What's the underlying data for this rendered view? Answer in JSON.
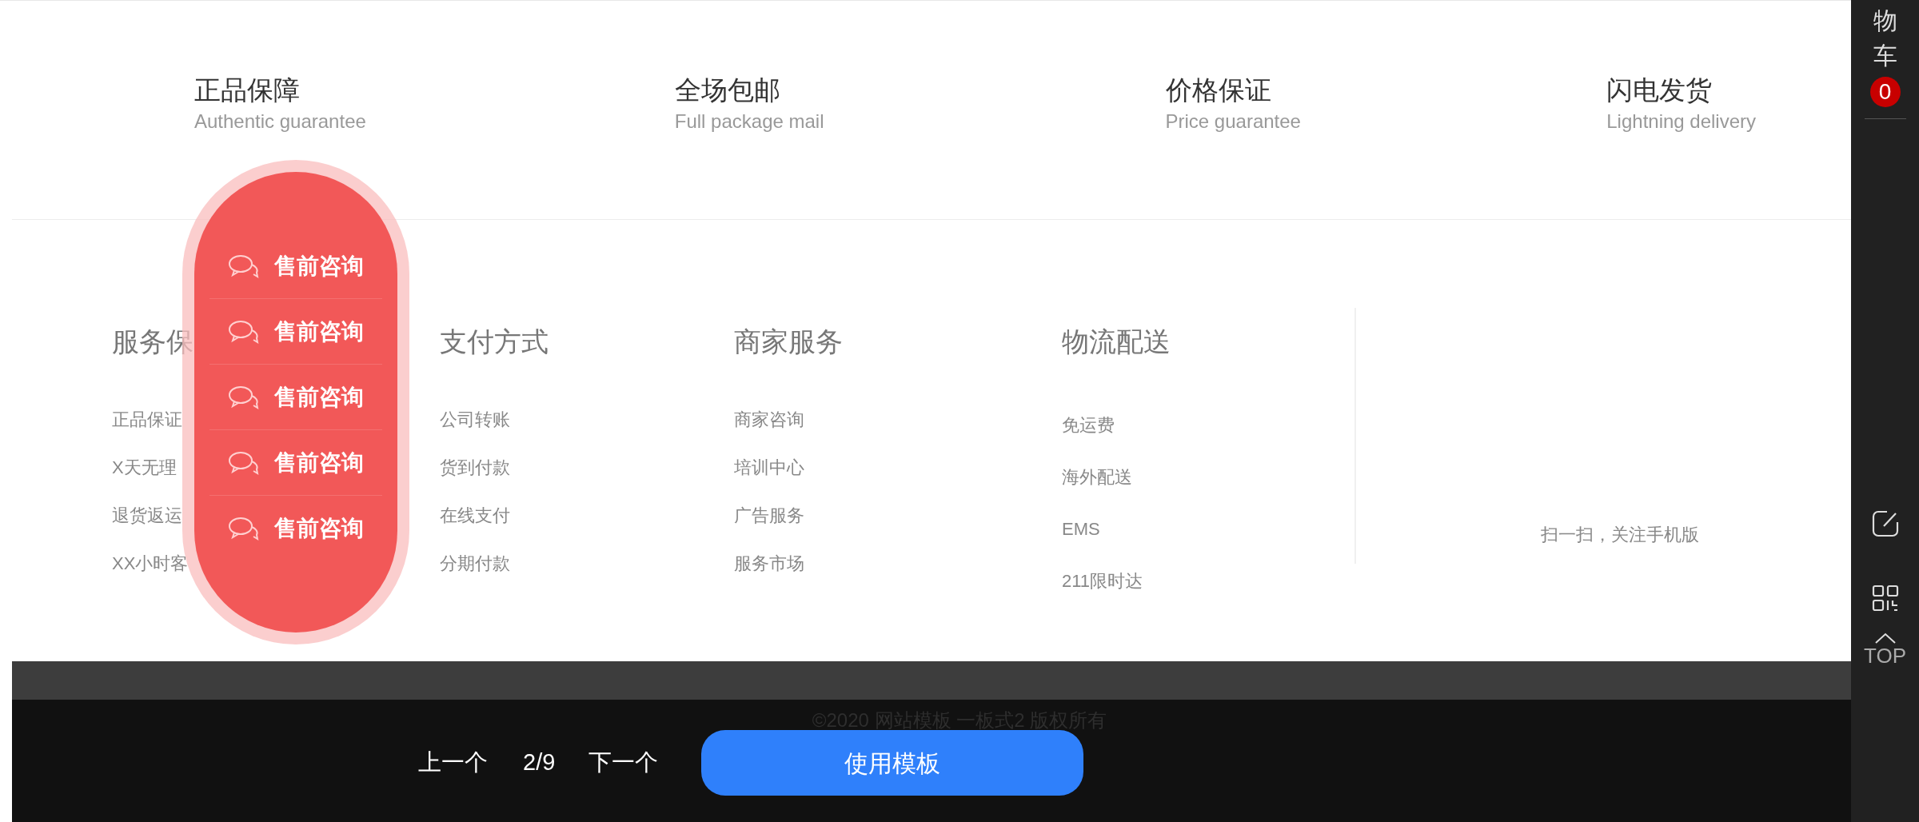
{
  "features": [
    {
      "title": "正品保障",
      "subtitle": "Authentic guarantee"
    },
    {
      "title": "全场包邮",
      "subtitle": "Full package mail"
    },
    {
      "title": "价格保证",
      "subtitle": "Price guarantee"
    },
    {
      "title": "闪电发货",
      "subtitle": "Lightning delivery"
    }
  ],
  "consult_menu": {
    "items": [
      "售前咨询",
      "售前咨询",
      "售前咨询",
      "售前咨询",
      "售前咨询"
    ]
  },
  "footer_columns": [
    {
      "heading": "服务保",
      "links": [
        "正品保证",
        "X天无理",
        "退货返运",
        "XX小时客"
      ]
    },
    {
      "heading": "支付方式",
      "links": [
        "公司转账",
        "货到付款",
        "在线支付",
        "分期付款"
      ]
    },
    {
      "heading": "商家服务",
      "links": [
        "商家咨询",
        "培训中心",
        "广告服务",
        "服务市场"
      ]
    },
    {
      "heading": "物流配送",
      "links": [
        "免运费",
        "海外配送",
        "EMS",
        "211限时达"
      ]
    }
  ],
  "qr_caption": "扫一扫，关注手机版",
  "copyright": "©2020 网站模板 一板式2 版权所有",
  "template_bar": {
    "prev": "上一个",
    "page": "2/9",
    "next": "下一个",
    "use_button": "使用模板"
  },
  "sidebar": {
    "cart_label": "物车",
    "cart_count": "0",
    "top_label": "TOP"
  }
}
